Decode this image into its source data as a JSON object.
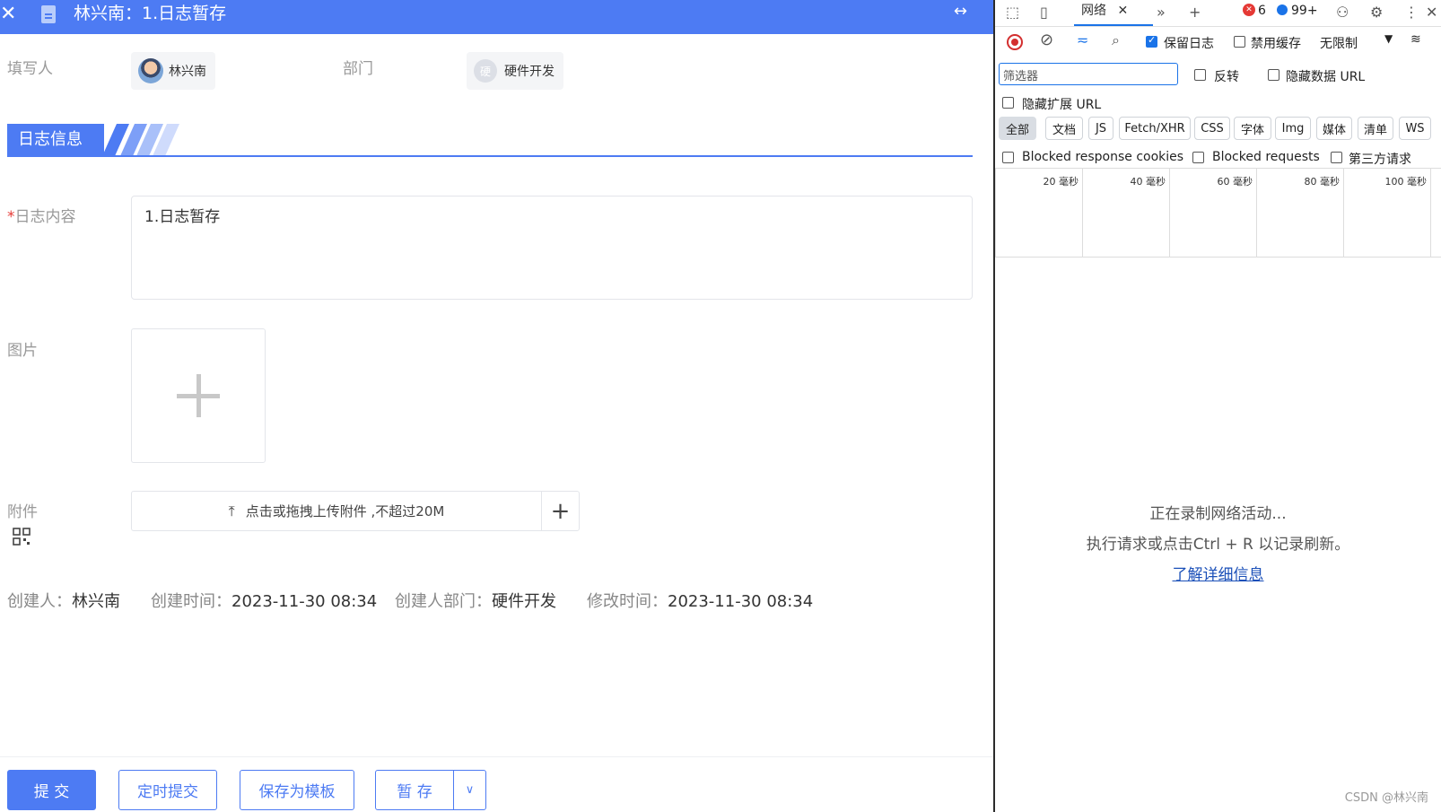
{
  "form": {
    "window_title": "林兴南：1.日志暂存",
    "filler_label": "填写人",
    "filler_name": "林兴南",
    "dept_label": "部门",
    "dept_avatar_text": "硬",
    "dept_name": "硬件开发",
    "section_title": "日志信息",
    "content_label_req": "*",
    "content_label": "日志内容",
    "content_value": "1.日志暂存",
    "image_label": "图片",
    "attach_label": "附件",
    "attach_hint": "点击或拖拽上传附件 ,不超过20M",
    "meta": {
      "creator_label": "创建人：",
      "creator": "林兴南",
      "created_label": "创建时间：",
      "created": "2023-11-30 08:34",
      "dept_label": "创建人部门：",
      "dept": "硬件开发",
      "modified_label": "修改时间：",
      "modified": "2023-11-30 08:34"
    },
    "buttons": {
      "submit": "提 交",
      "timed": "定时提交",
      "template": "保存为模板",
      "draft": "暂 存"
    }
  },
  "devtools": {
    "network_tab": "网络",
    "error_count": "6",
    "info_count": "99+",
    "preserve_log": "保留日志",
    "disable_cache": "禁用缓存",
    "throttle": "无限制",
    "filter_placeholder": "筛选器",
    "invert": "反转",
    "hide_data_url": "隐藏数据 URL",
    "hide_ext_url": "隐藏扩展 URL",
    "type_filters": [
      "全部",
      "文档",
      "JS",
      "Fetch/XHR",
      "CSS",
      "字体",
      "Img",
      "媒体",
      "清单",
      "WS"
    ],
    "blocked_cookies": "Blocked response cookies",
    "blocked_requests": "Blocked requests",
    "third_party": "第三方请求",
    "timeline_ticks": [
      "20 毫秒",
      "40 毫秒",
      "60 毫秒",
      "80 毫秒",
      "100 毫秒"
    ],
    "recording": "正在录制网络活动...",
    "hint": "执行请求或点击Ctrl + R 以记录刷新。",
    "learn_more": "了解详细信息"
  },
  "watermark": "CSDN @林兴南"
}
